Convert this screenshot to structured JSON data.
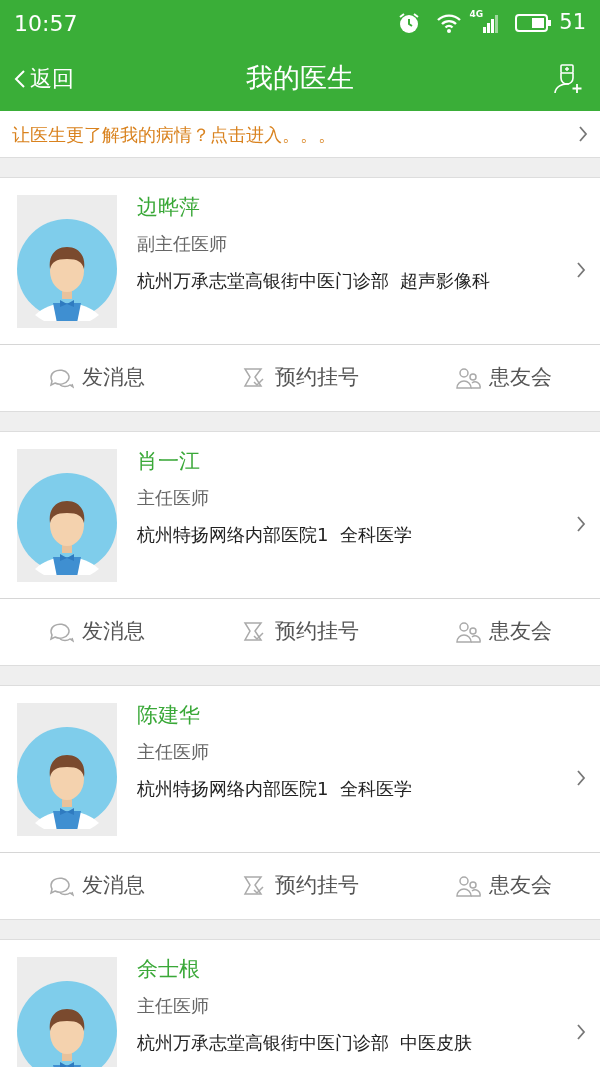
{
  "status_bar": {
    "time": "10:57",
    "network": "4G",
    "battery": "51"
  },
  "nav": {
    "back": "返回",
    "title": "我的医生"
  },
  "banner": {
    "text": "让医生更了解我的病情？点击进入。。。"
  },
  "doctors": [
    {
      "name": "边晔萍",
      "title": "副主任医师",
      "hospital": "杭州万承志堂高银街中医门诊部  超声影像科",
      "actions": [
        {
          "kind": "message",
          "label": "发消息"
        },
        {
          "kind": "appointment",
          "label": "预约挂号"
        },
        {
          "kind": "community",
          "label": "患友会"
        }
      ]
    },
    {
      "name": "肖一江",
      "title": "主任医师",
      "hospital": "杭州特扬网络内部医院1  全科医学",
      "actions": [
        {
          "kind": "message",
          "label": "发消息"
        },
        {
          "kind": "appointment",
          "label": "预约挂号"
        },
        {
          "kind": "community",
          "label": "患友会"
        }
      ]
    },
    {
      "name": "陈建华",
      "title": "主任医师",
      "hospital": "杭州特扬网络内部医院1  全科医学",
      "actions": [
        {
          "kind": "message",
          "label": "发消息"
        },
        {
          "kind": "appointment",
          "label": "预约挂号"
        },
        {
          "kind": "community",
          "label": "患友会"
        }
      ]
    },
    {
      "name": "余士根",
      "title": "主任医师",
      "hospital": "杭州万承志堂高银街中医门诊部  中医皮肤"
    }
  ]
}
